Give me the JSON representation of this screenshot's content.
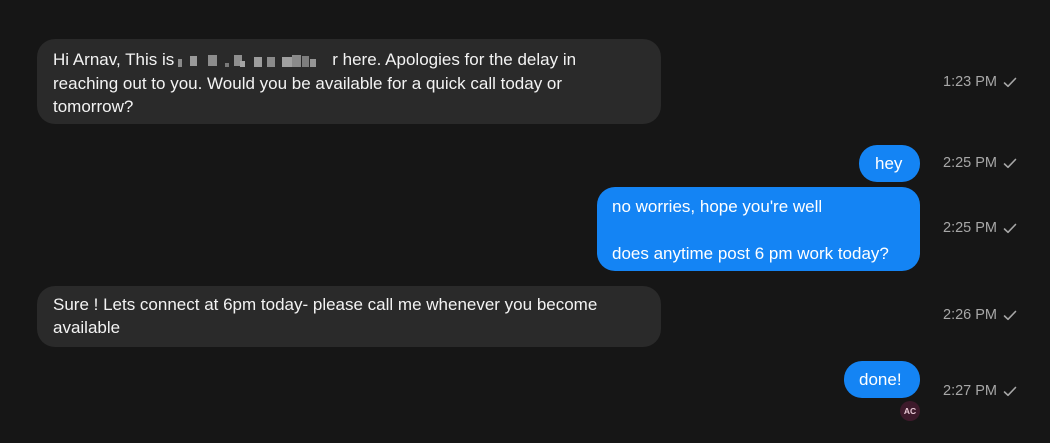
{
  "messages": [
    {
      "dir": "incoming",
      "text_before": "Hi Arnav, This is",
      "text_after": "r here. Apologies for the delay in reaching out to you. Would you be available for a quick call today or tomorrow?",
      "time": "1:23 PM"
    },
    {
      "dir": "outgoing",
      "text": "hey",
      "time": "2:25 PM"
    },
    {
      "dir": "outgoing",
      "text": "no worries, hope you're well\n\ndoes anytime post 6 pm work today?",
      "time": "2:25 PM"
    },
    {
      "dir": "incoming",
      "text": "Sure ! Lets connect at 6pm today- please call me whenever you become available",
      "time": "2:26 PM"
    },
    {
      "dir": "outgoing",
      "text": "done!",
      "time": "2:27 PM"
    }
  ],
  "read_receipt": {
    "initials": "AC"
  },
  "colors": {
    "background": "#161616",
    "incoming_bubble": "#2a2a2a",
    "outgoing_bubble": "#1484f4",
    "timestamp": "#a7a7a7"
  },
  "icons": {
    "status": "checkmark-icon"
  }
}
